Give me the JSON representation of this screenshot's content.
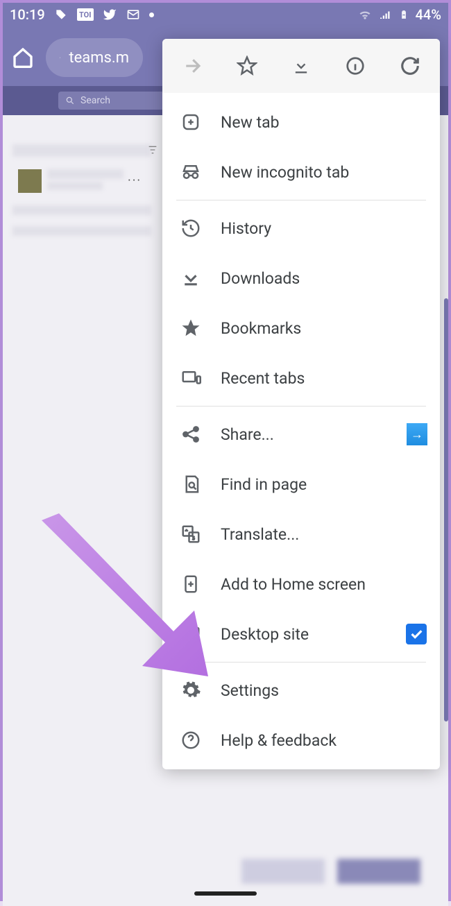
{
  "status": {
    "time": "10:19",
    "battery_text": "44%"
  },
  "browser": {
    "url_display": "teams.m"
  },
  "teams": {
    "search_placeholder": "Search"
  },
  "menu": {
    "items": {
      "new_tab": "New tab",
      "incognito": "New incognito tab",
      "history": "History",
      "downloads": "Downloads",
      "bookmarks": "Bookmarks",
      "recent_tabs": "Recent tabs",
      "share": "Share...",
      "find": "Find in page",
      "translate": "Translate...",
      "add_home": "Add to Home screen",
      "desktop_site": "Desktop site",
      "settings": "Settings",
      "help": "Help & feedback"
    },
    "desktop_site_checked": true
  }
}
